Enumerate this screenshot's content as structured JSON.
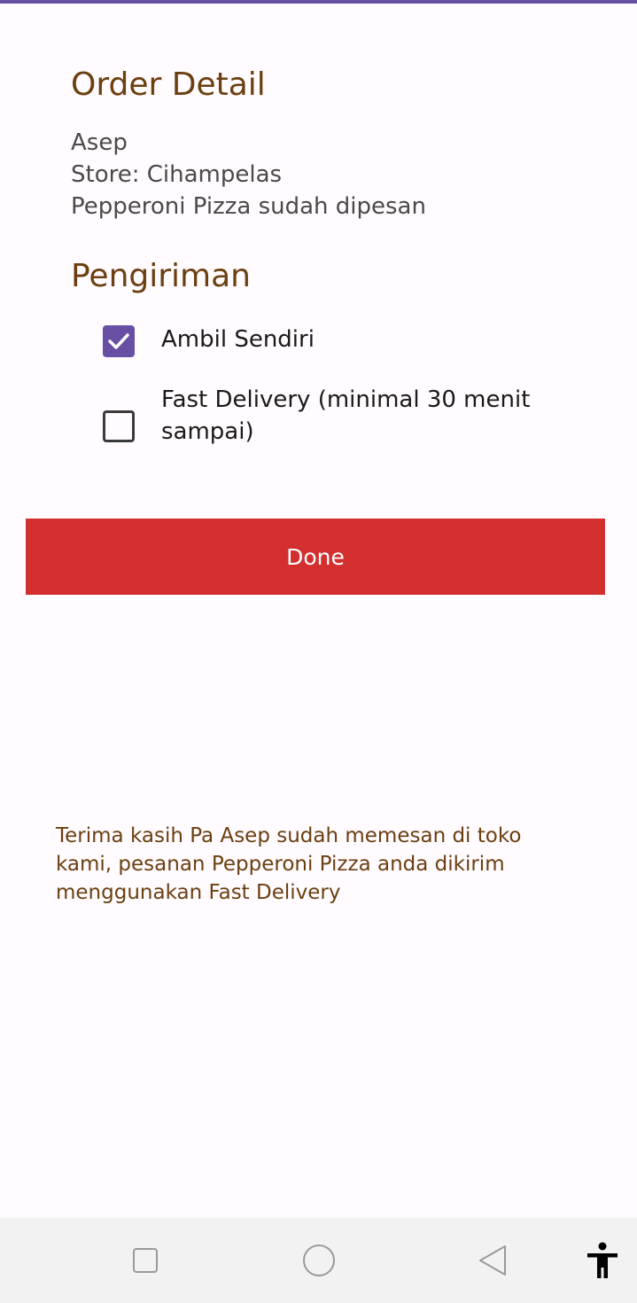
{
  "order": {
    "title": "Order Detail",
    "customer_name": "Asep",
    "store_line": "Store:  Cihampelas",
    "item_line": "Pepperoni Pizza sudah dipesan"
  },
  "shipping": {
    "title": "Pengiriman",
    "options": [
      {
        "label": "Ambil Sendiri",
        "checked": true
      },
      {
        "label": "Fast Delivery (minimal 30 menit sampai)",
        "checked": false
      }
    ]
  },
  "done_button": {
    "label": "Done"
  },
  "message": "Terima kasih Pa Asep sudah memesan di toko kami,  pesanan Pepperoni Pizza anda dikirim menggunakan Fast Delivery",
  "colors": {
    "accent": "#6750a4",
    "heading": "#6b3f10",
    "button": "#d32f2f"
  },
  "nav": {
    "recent_icon": "square-icon",
    "home_icon": "circle-icon",
    "back_icon": "triangle-back-icon",
    "accessibility_icon": "accessibility-icon"
  }
}
